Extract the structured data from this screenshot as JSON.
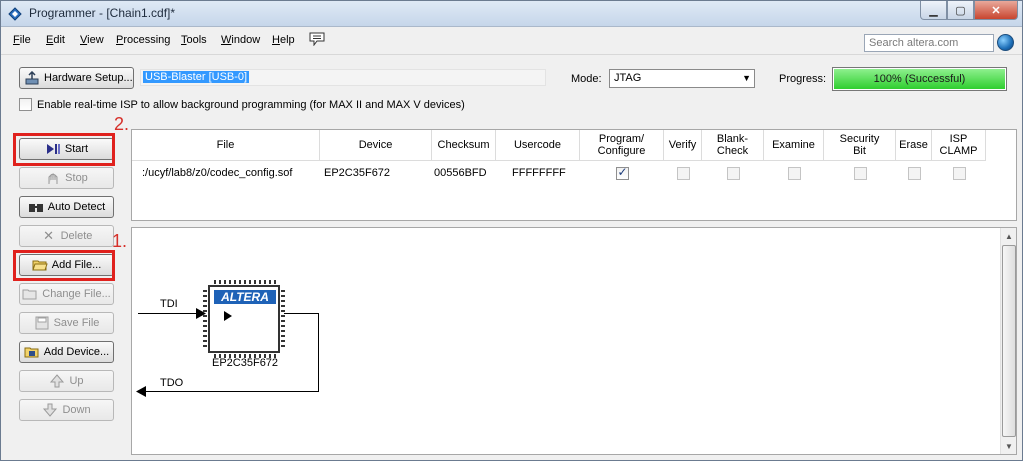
{
  "window": {
    "title": "Programmer - [Chain1.cdf]*",
    "minimize": "▁",
    "maximize": "▢",
    "close": "✕"
  },
  "menu": {
    "items": [
      "File",
      "Edit",
      "View",
      "Processing",
      "Tools",
      "Window",
      "Help"
    ],
    "search_placeholder": "Search altera.com"
  },
  "toolbar": {
    "hardware_setup_label": "Hardware Setup...",
    "hardware_value": "USB-Blaster [USB-0]",
    "mode_label": "Mode:",
    "mode_value": "JTAG",
    "progress_label": "Progress:",
    "progress_text": "100% (Successful)",
    "progress_fraction": 1.0,
    "isp_label": "Enable real-time ISP to allow background programming (for MAX II and MAX V devices)"
  },
  "side_buttons": {
    "start": "Start",
    "stop": "Stop",
    "auto_detect": "Auto Detect",
    "delete": "Delete",
    "add_file": "Add File...",
    "change_file": "Change File...",
    "save_file": "Save File",
    "add_device": "Add Device...",
    "up": "Up",
    "down": "Down"
  },
  "annotations": {
    "step1": "1.",
    "step2": "2."
  },
  "table": {
    "headers": {
      "file": "File",
      "device": "Device",
      "checksum": "Checksum",
      "usercode": "Usercode",
      "program": "Program/\nConfigure",
      "verify": "Verify",
      "blank_check": "Blank-\nCheck",
      "examine": "Examine",
      "security_bit": "Security\nBit",
      "erase": "Erase",
      "isp_clamp": "ISP\nCLAMP"
    },
    "row": {
      "file": ":/ucyf/lab8/z0/codec_config.sof",
      "device": "EP2C35F672",
      "checksum": "00556BFD",
      "usercode": "FFFFFFFF",
      "program_configure": true,
      "verify": false,
      "blank_check": false,
      "examine": false,
      "security_bit": false,
      "erase": false,
      "isp_clamp": false
    }
  },
  "chain": {
    "tdi": "TDI",
    "tdo": "TDO",
    "device_name": "EP2C35F672",
    "chip_logo": "ALTERA"
  },
  "colors": {
    "annotation_red": "#e0211d",
    "progress_green": "#2fce2f",
    "selection_blue": "#3399ff"
  }
}
